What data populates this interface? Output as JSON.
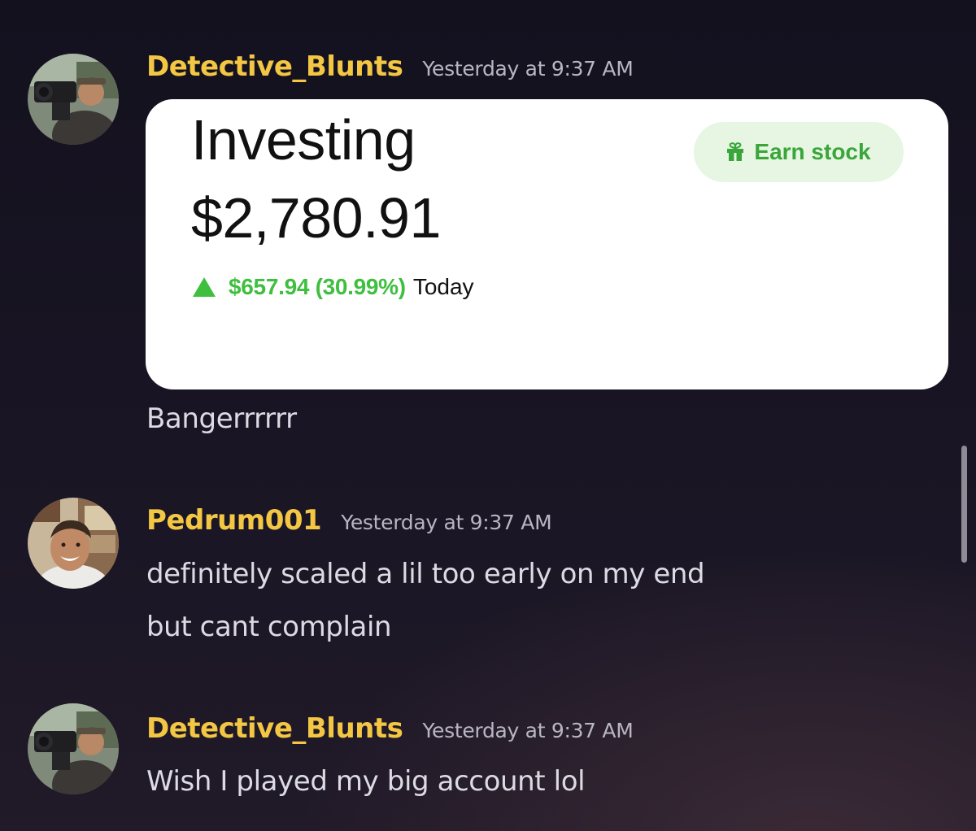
{
  "messages": [
    {
      "username": "Detective_Blunts",
      "timestamp": "Yesterday at 9:37 AM",
      "attachment": {
        "title": "Investing",
        "amount": "$2,780.91",
        "change": "$657.94 (30.99%)",
        "period": "Today",
        "button_label": "Earn stock",
        "button_icon": "gift-icon",
        "change_icon": "triangle-up-icon",
        "change_color": "#3fbf3f"
      },
      "lines": [
        "Bangerrrrrr"
      ]
    },
    {
      "username": "Pedrum001",
      "timestamp": "Yesterday at 9:37 AM",
      "lines": [
        "definitely scaled a lil too early on my end",
        "but cant complain"
      ]
    },
    {
      "username": "Detective_Blunts",
      "timestamp": "Yesterday at 9:37 AM",
      "lines": [
        "Wish I played my big account lol"
      ]
    }
  ],
  "colors": {
    "username": "#f3c744",
    "timestamp": "#b8b6c2",
    "text": "#dcdbe3",
    "background": "#191524"
  }
}
